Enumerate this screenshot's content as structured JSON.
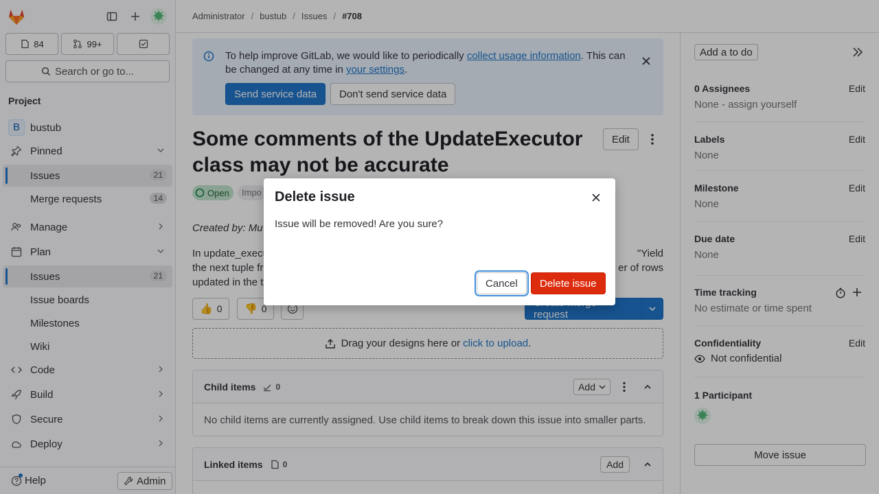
{
  "topbar": {
    "breadcrumbs": [
      "Administrator",
      "bustub",
      "Issues",
      "#708"
    ]
  },
  "sidebar": {
    "counters": {
      "issues": "84",
      "merge_requests": "99+"
    },
    "search_label": "Search or go to...",
    "context_label": "Project",
    "project": {
      "avatar": "B",
      "name": "bustub"
    },
    "pinned": {
      "label": "Pinned",
      "items": [
        {
          "label": "Issues",
          "count": "21"
        },
        {
          "label": "Merge requests",
          "count": "14"
        }
      ]
    },
    "manage": "Manage",
    "plan": {
      "label": "Plan",
      "items": [
        {
          "label": "Issues",
          "count": "21"
        },
        {
          "label": "Issue boards"
        },
        {
          "label": "Milestones"
        },
        {
          "label": "Wiki"
        }
      ]
    },
    "code": "Code",
    "build": "Build",
    "secure": "Secure",
    "deploy": "Deploy",
    "help": "Help",
    "admin": "Admin"
  },
  "banner": {
    "text_before": "To help improve GitLab, we would like to periodically ",
    "link1": "collect usage information",
    "text_middle": ". This can be changed at any time in ",
    "link2": "your settings",
    "text_after": ".",
    "send_button": "Send service data",
    "dont_send_button": "Don't send service data"
  },
  "issue": {
    "title": "Some comments of the UpdateExecutor class may not be accurate",
    "edit_button": "Edit",
    "status": "Open",
    "badge_partial": "Impo",
    "created_by_partial": "Created by: Mu",
    "desc_left_1": "In update_execu",
    "desc_right_1": "\"Yield",
    "desc_left_2": "the next tuple fr",
    "desc_right_2": "er of rows",
    "desc_left_3": "updated in the t",
    "thumbs_up": "0",
    "thumbs_down": "0",
    "create_mr_button": "Create merge request",
    "upload_text": "Drag your designs here or ",
    "upload_link": "click to upload",
    "upload_dot": "."
  },
  "child_items": {
    "title": "Child items",
    "count": "0",
    "add_button": "Add",
    "empty_text": "No child items are currently assigned. Use child items to break down this issue into smaller parts."
  },
  "linked_items": {
    "title": "Linked items",
    "count": "0",
    "add_button": "Add"
  },
  "right_sidebar": {
    "todo_button": "Add a to do",
    "assignees": {
      "title": "0 Assignees",
      "edit": "Edit",
      "value": "None - assign yourself"
    },
    "labels": {
      "title": "Labels",
      "edit": "Edit",
      "value": "None"
    },
    "milestone": {
      "title": "Milestone",
      "edit": "Edit",
      "value": "None"
    },
    "due_date": {
      "title": "Due date",
      "edit": "Edit",
      "value": "None"
    },
    "time_tracking": {
      "title": "Time tracking",
      "value": "No estimate or time spent"
    },
    "confidentiality": {
      "title": "Confidentiality",
      "edit": "Edit",
      "value": "Not confidential"
    },
    "participants": {
      "title": "1 Participant"
    },
    "move_button": "Move issue"
  },
  "modal": {
    "title": "Delete issue",
    "body": "Issue will be removed! Are you sure?",
    "cancel_button": "Cancel",
    "delete_button": "Delete issue"
  },
  "colors": {
    "brand_blue": "#1f75cb",
    "danger": "#dd2b0e",
    "success": "#108548",
    "tanuki": "#e24329"
  }
}
